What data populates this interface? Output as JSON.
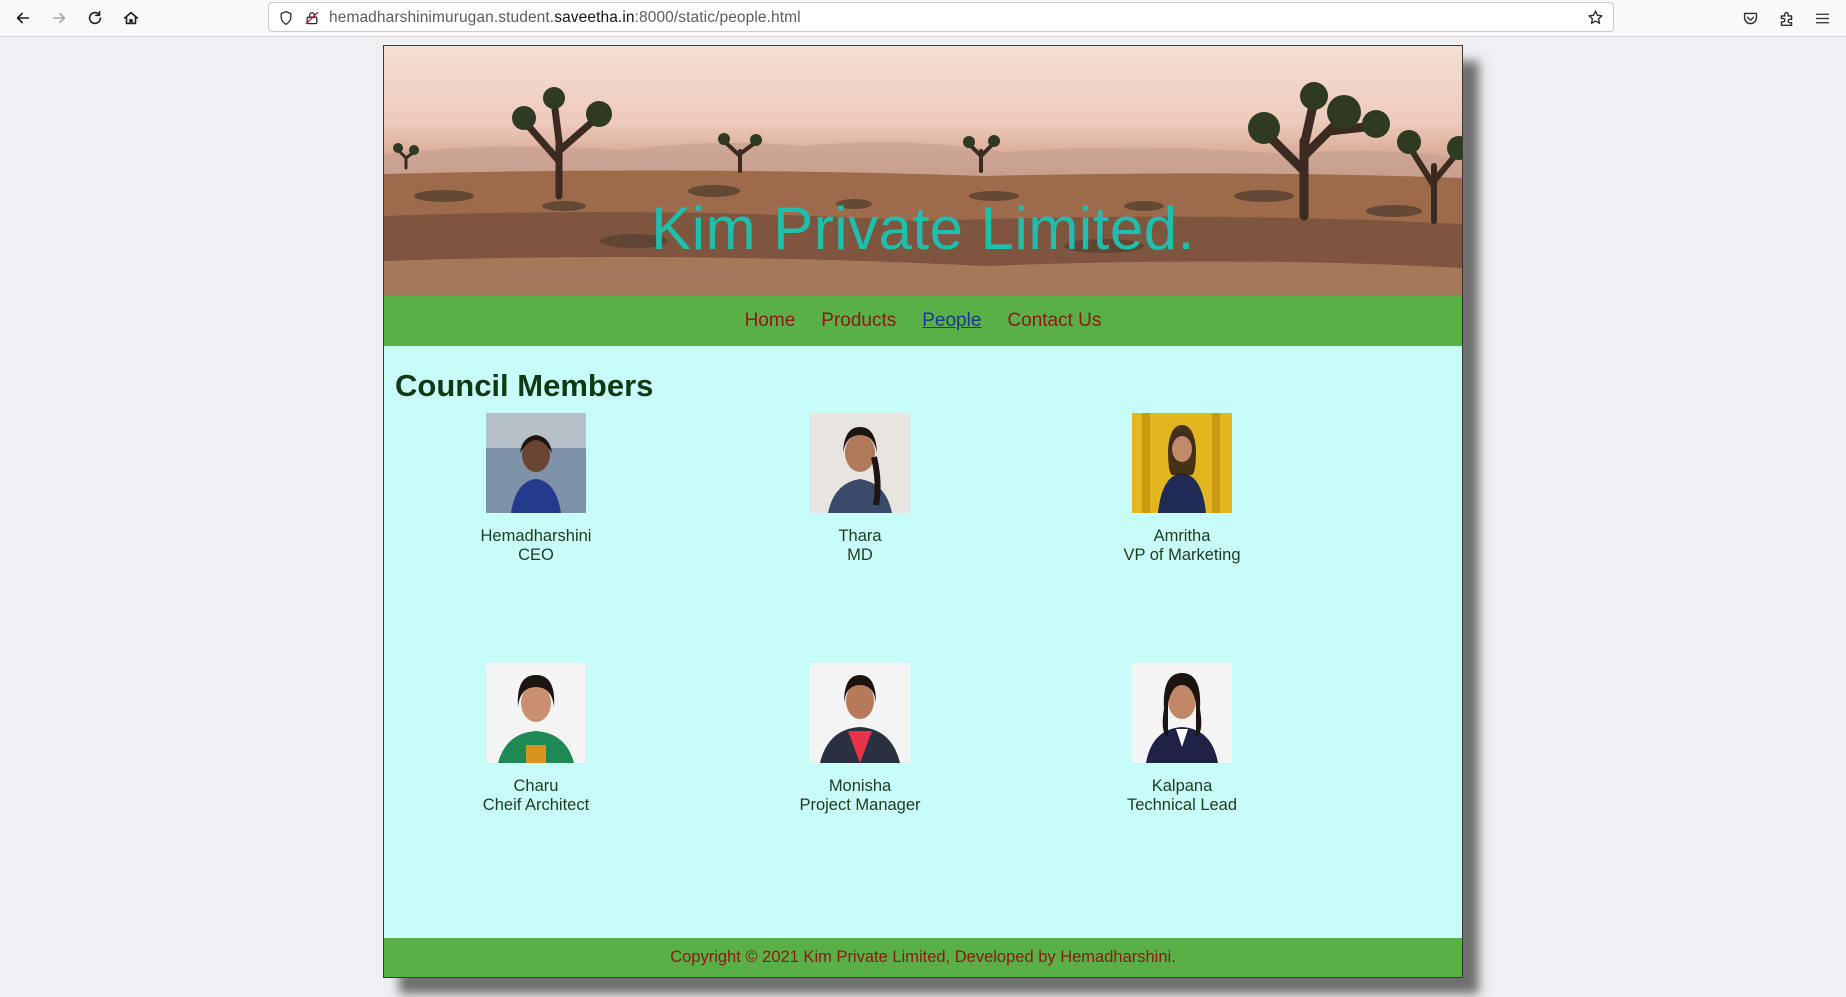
{
  "browser": {
    "url_prefix": "hemadharshinimurugan.student.",
    "url_host": "saveetha.in",
    "url_suffix": ":8000/static/people.html"
  },
  "site": {
    "title": "Kim Private Limited.",
    "nav": [
      {
        "label": "Home"
      },
      {
        "label": "Products"
      },
      {
        "label": "People"
      },
      {
        "label": "Contact Us"
      }
    ],
    "heading": "Council Members",
    "members": [
      {
        "name": "Hemadharshini",
        "role": "CEO"
      },
      {
        "name": "Thara",
        "role": "MD"
      },
      {
        "name": "Amritha",
        "role": "VP of Marketing"
      },
      {
        "name": "Charu",
        "role": "Cheif Architect"
      },
      {
        "name": "Monisha",
        "role": "Project Manager"
      },
      {
        "name": "Kalpana",
        "role": "Technical Lead"
      }
    ],
    "footer": "Copyright © 2021 Kim Private Limited, Developed by Hemadharshini."
  },
  "colors": {
    "nav_bg": "#58b046",
    "link": "#8b1a10",
    "content_bg": "#c8fcf8",
    "title": "#1fbfae"
  }
}
